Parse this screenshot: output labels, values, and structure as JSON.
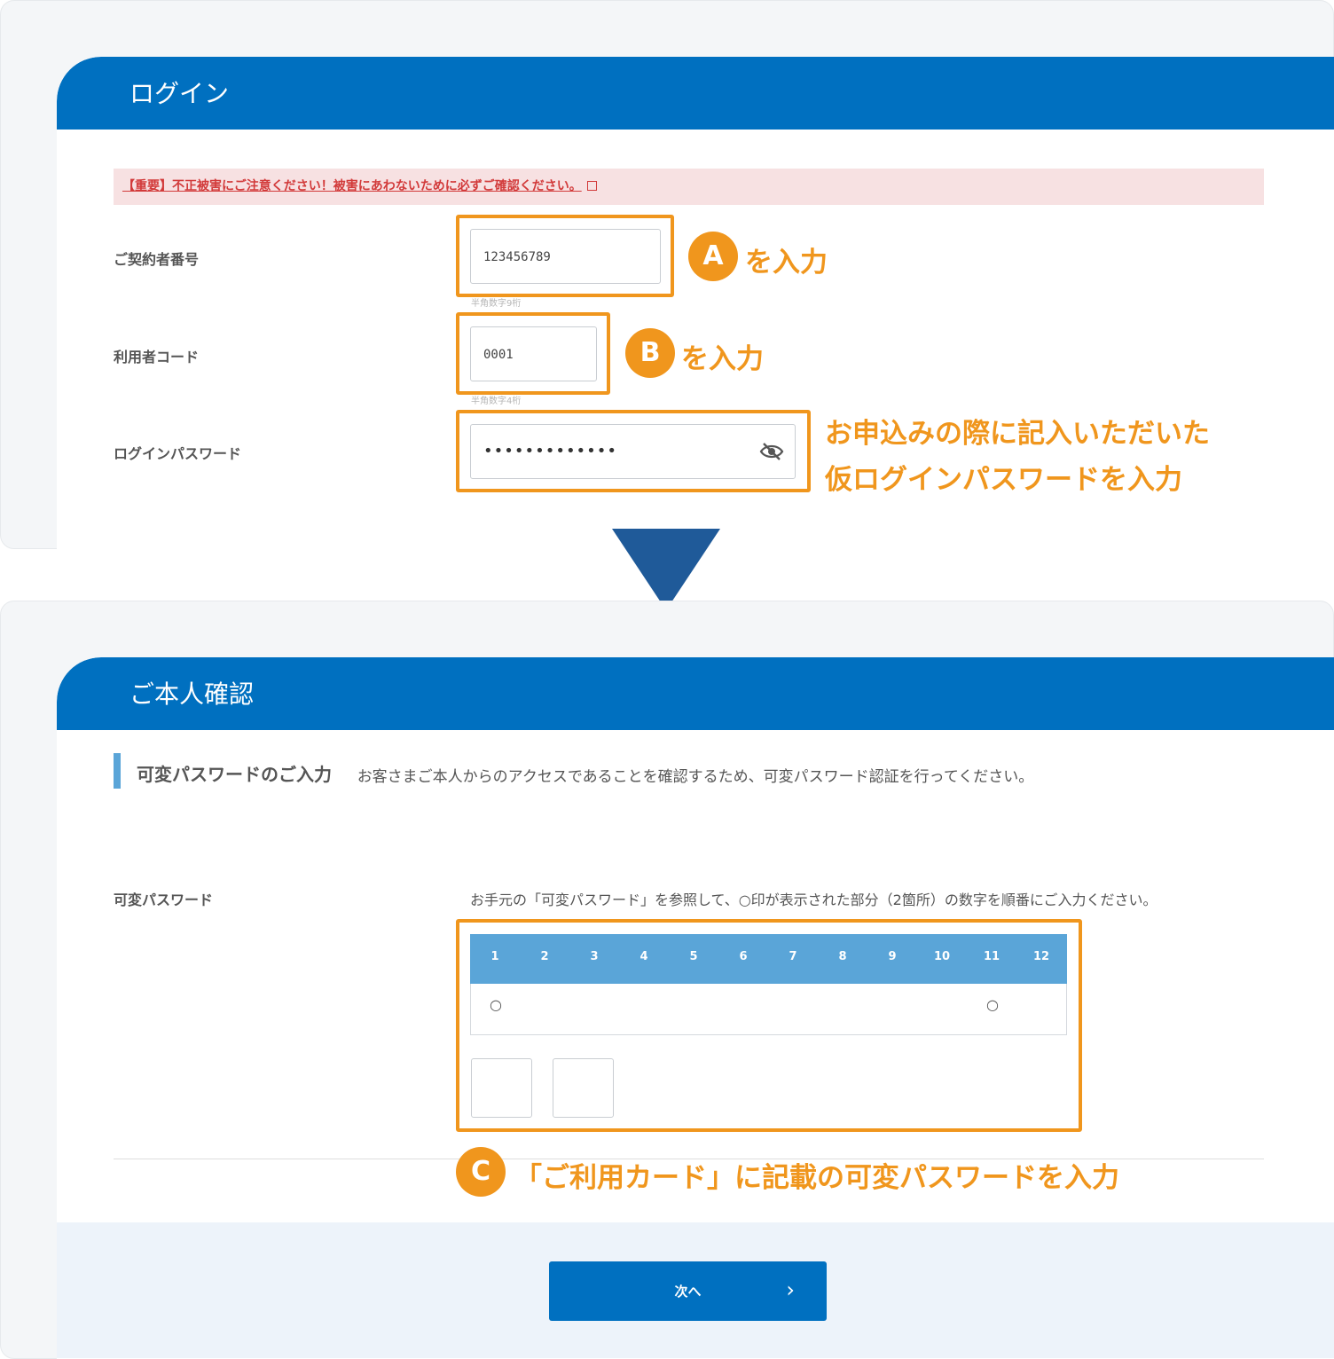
{
  "login": {
    "title": "ログイン",
    "notice": "【重要】不正被害にご注意ください！被害にあわないために必ずご確認ください。",
    "contract_label": "ご契約者番号",
    "contract_value": "123456789",
    "contract_hint": "半角数字9桁",
    "user_code_label": "利用者コード",
    "user_code_value": "0001",
    "user_code_hint": "半角数字4桁",
    "password_label": "ログインパスワード",
    "password_value": "•••••••••••••"
  },
  "annotations": {
    "a_badge": "A",
    "a_text": "を入力",
    "b_badge": "B",
    "b_text": "を入力",
    "pw_line1": "お申込みの際に記入いただいた",
    "pw_line2": "仮ログインパスワードを入力",
    "c_badge": "C",
    "c_text": "「ご利用カード」に記載の可変パスワードを入力"
  },
  "verify": {
    "title": "ご本人確認",
    "description": "お客さまご本人からのアクセスであることを確認するため、可変パスワード認証を行ってください。",
    "section_title": "可変パスワードのご入力",
    "field_label": "可変パスワード",
    "field_desc": "お手元の「可変パスワード」を参照して、○印が表示された部分（2箇所）の数字を順番にご入力ください。",
    "columns": [
      "1",
      "2",
      "3",
      "4",
      "5",
      "6",
      "7",
      "8",
      "9",
      "10",
      "11",
      "12"
    ],
    "marks": [
      "○",
      "",
      "",
      "",
      "",
      "",
      "",
      "",
      "",
      "",
      "○",
      ""
    ],
    "next_label": "次へ",
    "next_chevron": "›"
  },
  "colors": {
    "brand_blue": "#0070c0",
    "highlight_orange": "#f0961d",
    "arrow_blue": "#1f5a99",
    "grid_blue": "#5aa5d8"
  }
}
